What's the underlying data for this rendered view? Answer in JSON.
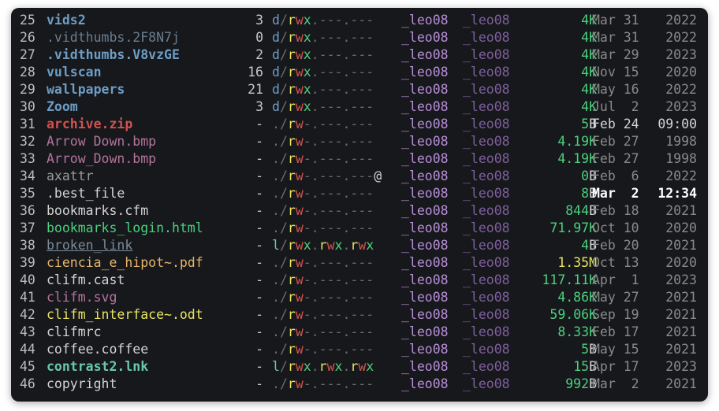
{
  "rows": [
    {
      "n": "25",
      "name": "vids2",
      "cls": "c-dir",
      "cnt": "3",
      "perm": "d/rwx.---.---",
      "user": "_leo08",
      "group": "_leo08",
      "size": "4",
      "unit": "K",
      "month": "Mar",
      "day": "31",
      "time": "2022"
    },
    {
      "n": "26",
      "name": ".vidthumbs.2F8N7j",
      "cls": "c-dirh",
      "cnt": "0",
      "perm": "d/rwx.---.---",
      "user": "_leo08",
      "group": "_leo08",
      "size": "4",
      "unit": "K",
      "month": "Mar",
      "day": "31",
      "time": "2022"
    },
    {
      "n": "27",
      "name": ".vidthumbs.V8vzGE",
      "cls": "c-dir",
      "cnt": "2",
      "perm": "d/rwx.---.---",
      "user": "_leo08",
      "group": "_leo08",
      "size": "4",
      "unit": "K",
      "month": "Mar",
      "day": "29",
      "time": "2023"
    },
    {
      "n": "28",
      "name": "vulscan",
      "cls": "c-dir",
      "cnt": "16",
      "perm": "d/rwx.---.---",
      "user": "_leo08",
      "group": "_leo08",
      "size": "4",
      "unit": "K",
      "month": "Nov",
      "day": "15",
      "time": "2020"
    },
    {
      "n": "29",
      "name": "wallpapers",
      "cls": "c-dir",
      "cnt": "21",
      "perm": "d/rwx.---.---",
      "user": "_leo08",
      "group": "_leo08",
      "size": "4",
      "unit": "K",
      "month": "May",
      "day": "16",
      "time": "2022"
    },
    {
      "n": "30",
      "name": "Zoom",
      "cls": "c-dir",
      "cnt": "3",
      "perm": "d/rwx.---.---",
      "user": "_leo08",
      "group": "_leo08",
      "size": "4",
      "unit": "K",
      "month": "Jul",
      "day": "2",
      "time": "2023"
    },
    {
      "n": "31",
      "name": "archive.zip",
      "cls": "c-arc",
      "cnt": "-",
      "perm": "./rw-.---.---",
      "user": "_leo08",
      "group": "_leo08",
      "size": "5",
      "unit": "B",
      "month": "Feb",
      "day": "24",
      "time": "09:00",
      "hl": true
    },
    {
      "n": "32",
      "name": "Arrow Down.bmp",
      "cls": "c-img",
      "cnt": "-",
      "perm": "./rw-.---.---",
      "user": "_leo08",
      "group": "_leo08",
      "size": "4.19",
      "unit": "K",
      "month": "Feb",
      "day": "27",
      "time": "1998"
    },
    {
      "n": "33",
      "name": "Arrow_Down.bmp",
      "cls": "c-img",
      "cnt": "-",
      "perm": "./rw-.---.---",
      "user": "_leo08",
      "group": "_leo08",
      "size": "4.19",
      "unit": "K",
      "month": "Feb",
      "day": "27",
      "time": "1998"
    },
    {
      "n": "34",
      "name": "axattr",
      "cls": "c-gray",
      "cnt": "-",
      "perm": "./rw-.---.---@",
      "user": "_leo08",
      "group": "_leo08",
      "size": "0",
      "unit": "B",
      "month": "Feb",
      "day": "6",
      "time": "2022"
    },
    {
      "n": "35",
      "name": ".best_file",
      "cls": "c-white",
      "cnt": "-",
      "perm": "./rw-.---.---",
      "user": "_leo08",
      "group": "_leo08",
      "size": "8",
      "unit": "B",
      "month": "Mar",
      "day": "2",
      "time": "12:34",
      "bright": true
    },
    {
      "n": "36",
      "name": "bookmarks.cfm",
      "cls": "c-white",
      "cnt": "-",
      "perm": "./rw-.---.---",
      "user": "_leo08",
      "group": "_leo08",
      "size": "844",
      "unit": "B",
      "month": "Feb",
      "day": "18",
      "time": "2021"
    },
    {
      "n": "37",
      "name": "bookmarks_login.html",
      "cls": "c-green",
      "cnt": "-",
      "perm": "./rw-.---.---",
      "user": "_leo08",
      "group": "_leo08",
      "size": "71.97",
      "unit": "K",
      "month": "Oct",
      "day": "10",
      "time": "2020"
    },
    {
      "n": "38",
      "name": "broken_link",
      "cls": "c-brokn",
      "cnt": "-",
      "perm": "l/rwx.rwx.rwx",
      "user": "_leo08",
      "group": "_leo08",
      "size": "4",
      "unit": "B",
      "month": "Feb",
      "day": "20",
      "time": "2021"
    },
    {
      "n": "39",
      "name": "ciencia_e_hipot~.pdf",
      "cls": "c-pdf",
      "cnt": "-",
      "perm": "./rw-.---.---",
      "user": "_leo08",
      "group": "_leo08",
      "size": "1.35",
      "unit": "M",
      "month": "Oct",
      "day": "13",
      "time": "2020"
    },
    {
      "n": "40",
      "name": "clifm.cast",
      "cls": "c-white",
      "cnt": "-",
      "perm": "./rw-.---.---",
      "user": "_leo08",
      "group": "_leo08",
      "size": "117.11",
      "unit": "K",
      "month": "Apr",
      "day": "1",
      "time": "2023"
    },
    {
      "n": "41",
      "name": "clifm.svg",
      "cls": "c-svg",
      "cnt": "-",
      "perm": "./rw-.---.---",
      "user": "_leo08",
      "group": "_leo08",
      "size": "4.86",
      "unit": "K",
      "month": "May",
      "day": "27",
      "time": "2021"
    },
    {
      "n": "42",
      "name": "clifm_interface~.odt",
      "cls": "c-odt",
      "cnt": "-",
      "perm": "./rw-.---.---",
      "user": "_leo08",
      "group": "_leo08",
      "size": "59.06",
      "unit": "K",
      "month": "Sep",
      "day": "19",
      "time": "2021"
    },
    {
      "n": "43",
      "name": "clifmrc",
      "cls": "c-white",
      "cnt": "-",
      "perm": "./rw-.---.---",
      "user": "_leo08",
      "group": "_leo08",
      "size": "8.33",
      "unit": "K",
      "month": "Feb",
      "day": "17",
      "time": "2021"
    },
    {
      "n": "44",
      "name": "coffee.coffee",
      "cls": "c-white",
      "cnt": "-",
      "perm": "./rw-.---.---",
      "user": "_leo08",
      "group": "_leo08",
      "size": "5",
      "unit": "B",
      "month": "May",
      "day": "15",
      "time": "2021"
    },
    {
      "n": "45",
      "name": "contrast2.lnk",
      "cls": "c-lnk",
      "cnt": "-",
      "perm": "l/rwx.rwx.rwx",
      "user": "_leo08",
      "group": "_leo08",
      "size": "15",
      "unit": "B",
      "month": "Apr",
      "day": "17",
      "time": "2023"
    },
    {
      "n": "46",
      "name": "copyright",
      "cls": "c-white",
      "cnt": "-",
      "perm": "./rw-.---.---",
      "user": "_leo08",
      "group": "_leo08",
      "size": "992",
      "unit": "B",
      "month": "Mar",
      "day": "2",
      "time": "2021"
    }
  ]
}
